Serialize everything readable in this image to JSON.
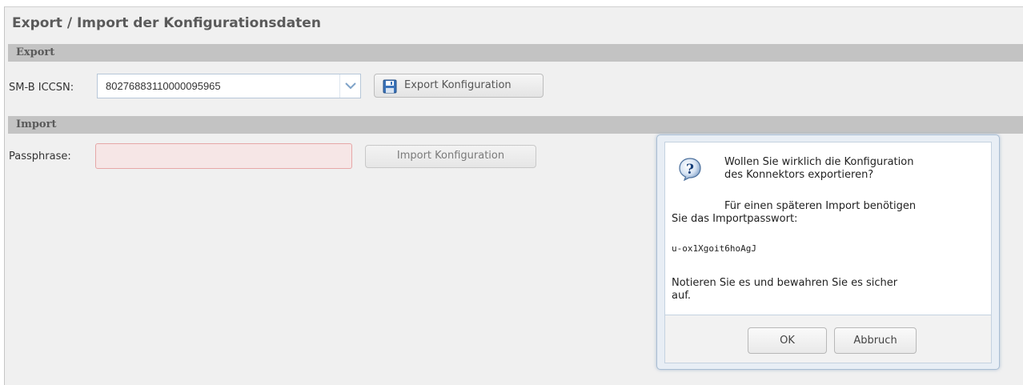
{
  "title": "Export / Import der Konfigurationsdaten",
  "export_section": {
    "heading": "Export",
    "iccsn_label": "SM-B ICCSN:",
    "iccsn_value": "80276883110000095965",
    "export_button": "Export Konfiguration"
  },
  "import_section": {
    "heading": "Import",
    "passphrase_label": "Passphrase:",
    "passphrase_value": "",
    "import_button": "Import Konfiguration"
  },
  "dialog": {
    "question_line1": "Wollen Sie wirklich die Konfiguration",
    "question_line2": "des Konnektors exportieren?",
    "info_line1": "Für einen späteren Import benötigen",
    "info_line2": "Sie das Importpasswort:",
    "password": "u-ox1Xgoit6hoAgJ",
    "note_line1": "Notieren Sie es und bewahren Sie es sicher",
    "note_line2": "auf.",
    "ok_button": "OK",
    "cancel_button": "Abbruch"
  },
  "colors": {
    "section_bar": "#c3c3c3",
    "invalid_field": "#f6e6e6",
    "dialog_border": "#a9bdd3"
  }
}
